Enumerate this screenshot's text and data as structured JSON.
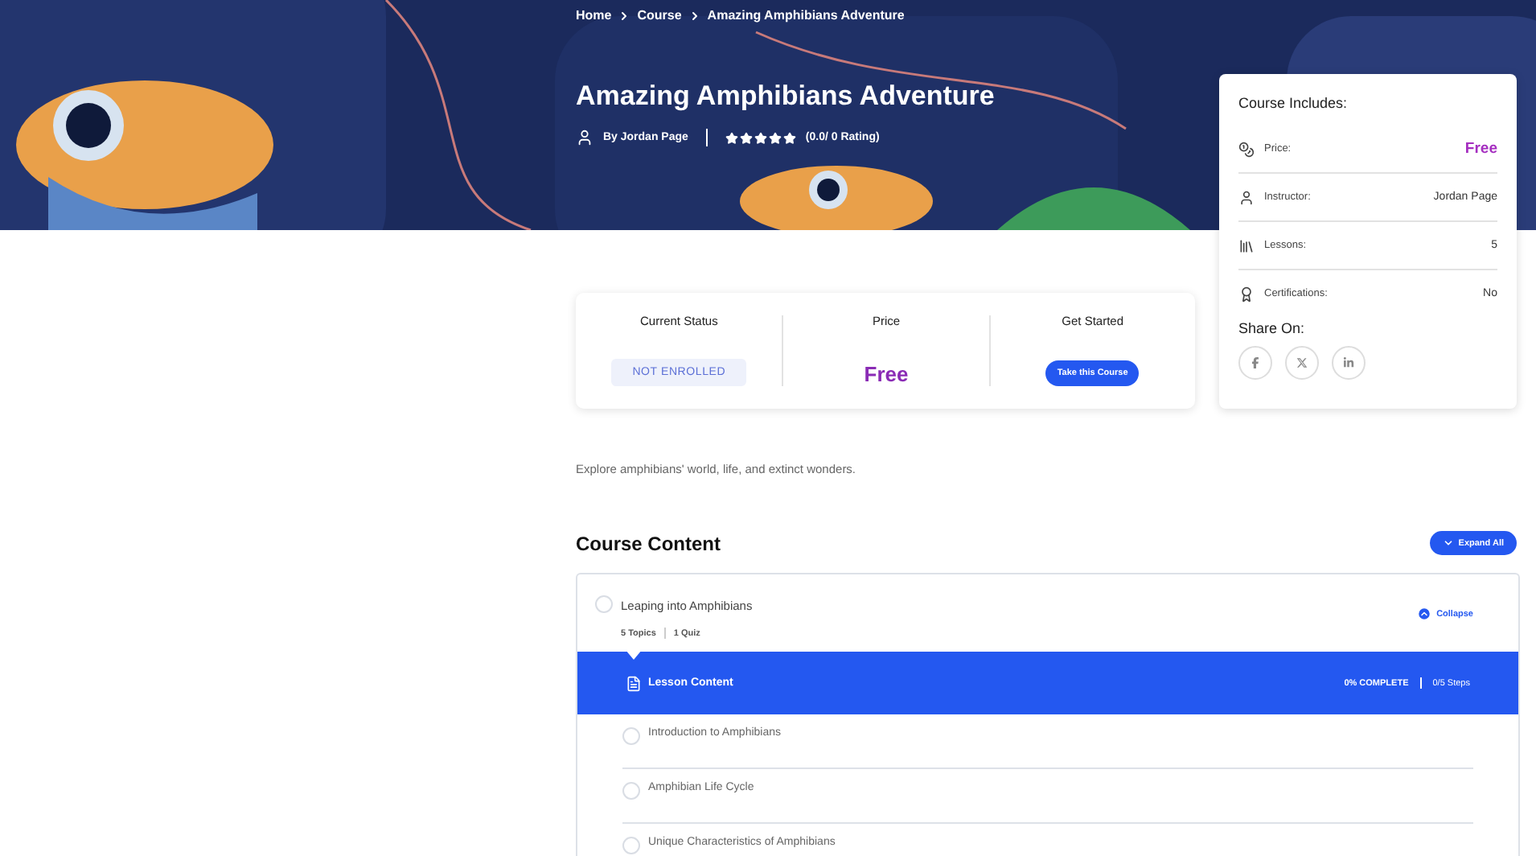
{
  "breadcrumb": [
    "Home",
    "Course",
    "Amazing Amphibians Adventure"
  ],
  "course": {
    "title": "Amazing Amphibians Adventure",
    "author": "By Jordan Page",
    "stars": 5,
    "rating": "(0.0/ 0 Rating)"
  },
  "status_card": {
    "status_label": "Current Status",
    "status": "NOT ENROLLED",
    "price_label": "Price",
    "price": "Free",
    "start_label": "Get Started",
    "start_button": "Take this Course"
  },
  "description": "Explore amphibians' world, life, and extinct wonders.",
  "includes": {
    "title": "Course Includes:",
    "rows": [
      {
        "kind": "price",
        "label": "Price:",
        "value": "Free"
      },
      {
        "kind": "instructor",
        "label": "Instructor:",
        "value": "Jordan Page"
      },
      {
        "kind": "lessons",
        "label": "Lessons:",
        "value": "5"
      },
      {
        "kind": "certifications",
        "label": "Certifications:",
        "value": "No"
      }
    ],
    "share_title": "Share On:"
  },
  "content": {
    "title": "Course Content",
    "expand_button": "Expand All",
    "sections": [
      {
        "title": "Leaping into Amphibians",
        "topics": "5 Topics",
        "quiz": "1 Quiz",
        "expanded": true,
        "toggle_label": "Collapse",
        "lesson_header": "Lesson Content",
        "progress": "0% COMPLETE",
        "steps": "0/5 Steps",
        "lessons": [
          "Introduction to Amphibians",
          "Amphibian Life Cycle",
          "Unique Characteristics of Amphibians"
        ]
      }
    ]
  }
}
